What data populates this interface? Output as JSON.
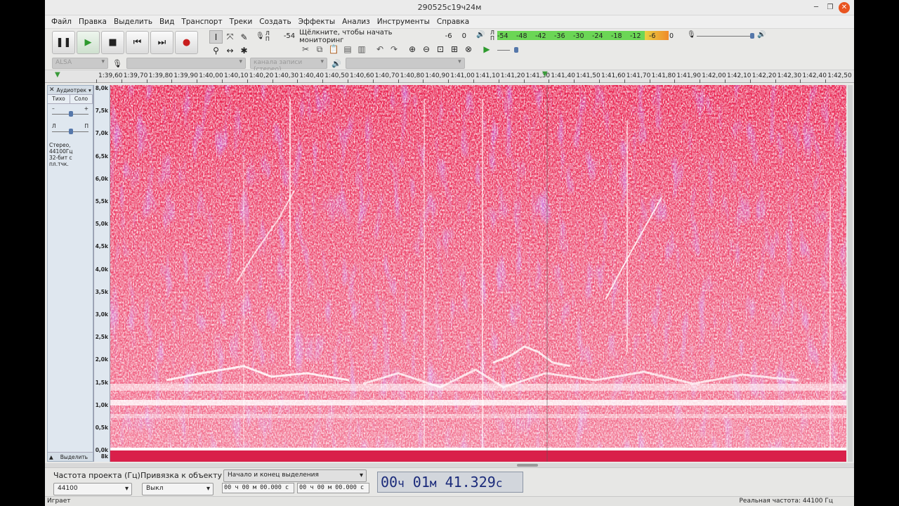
{
  "window": {
    "title": "290525c19ч24м"
  },
  "menu": [
    "Файл",
    "Правка",
    "Выделить",
    "Вид",
    "Транспорт",
    "Треки",
    "Создать",
    "Эффекты",
    "Анализ",
    "Инструменты",
    "Справка"
  ],
  "recording_meter": {
    "labels": [
      "-54",
      "Щёлкните, чтобы начать мониторинг",
      "-6",
      "0"
    ],
    "channel_top": "Л",
    "channel_bottom": "П"
  },
  "playback_meter": {
    "ticks": [
      "-54",
      "-48",
      "-42",
      "-36",
      "-30",
      "-24",
      "-18",
      "-12",
      "-6",
      "0"
    ],
    "channel_top": "Л",
    "channel_bottom": "П"
  },
  "device_bar": {
    "host": "ALSA",
    "channels": "канала записи (стерео)"
  },
  "ruler": {
    "ticks": [
      "1:39,60",
      "1:39,70",
      "1:39,80",
      "1:39,90",
      "1:40,00",
      "1:40,10",
      "1:40,20",
      "1:40,30",
      "1:40,40",
      "1:40,50",
      "1:40,60",
      "1:40,70",
      "1:40,80",
      "1:40,90",
      "1:41,00",
      "1:41,10",
      "1:41,20",
      "1:41,30",
      "1:41,40",
      "1:41,50",
      "1:41,60",
      "1:41,70",
      "1:41,80",
      "1:41,90",
      "1:42,00",
      "1:42,10",
      "1:42,20",
      "1:42,30",
      "1:42,40",
      "1:42,50"
    ]
  },
  "track": {
    "name": "Аудиотрек",
    "mute": "Тихо",
    "solo": "Соло",
    "pan_left": "Л",
    "pan_right": "П",
    "gain_minus": "–",
    "gain_plus": "+",
    "info_line1": "Стерео, 44100Гц",
    "info_line2": "32-бит с пл.тчк.",
    "select": "Выделить"
  },
  "freq_scale": [
    "8,0k",
    "7,5k",
    "7,0k",
    "6,5k",
    "6,0k",
    "5,5k",
    "5,0k",
    "4,5k",
    "4,0k",
    "3,5k",
    "3,0k",
    "2,5k",
    "2,0k",
    "1,5k",
    "1,0k",
    "0,5k",
    "0,0k",
    "8k"
  ],
  "selection_bar": {
    "rate_label": "Частота проекта (Гц)",
    "rate_value": "44100",
    "snap_label": "Привязка к объекту",
    "snap_value": "Выкл",
    "sel_mode": "Начало и конец выделения",
    "sel_start": "00 ч 00 м 00.000 с",
    "sel_end": "00 ч 00 м 00.000 с"
  },
  "time_display": {
    "h": "00",
    "hu": "ч",
    "m": "01",
    "mu": "м",
    "s": "41.329",
    "su": "с"
  },
  "status": {
    "left": "Играет",
    "right": "Реальная частота: 44100 Гц"
  }
}
